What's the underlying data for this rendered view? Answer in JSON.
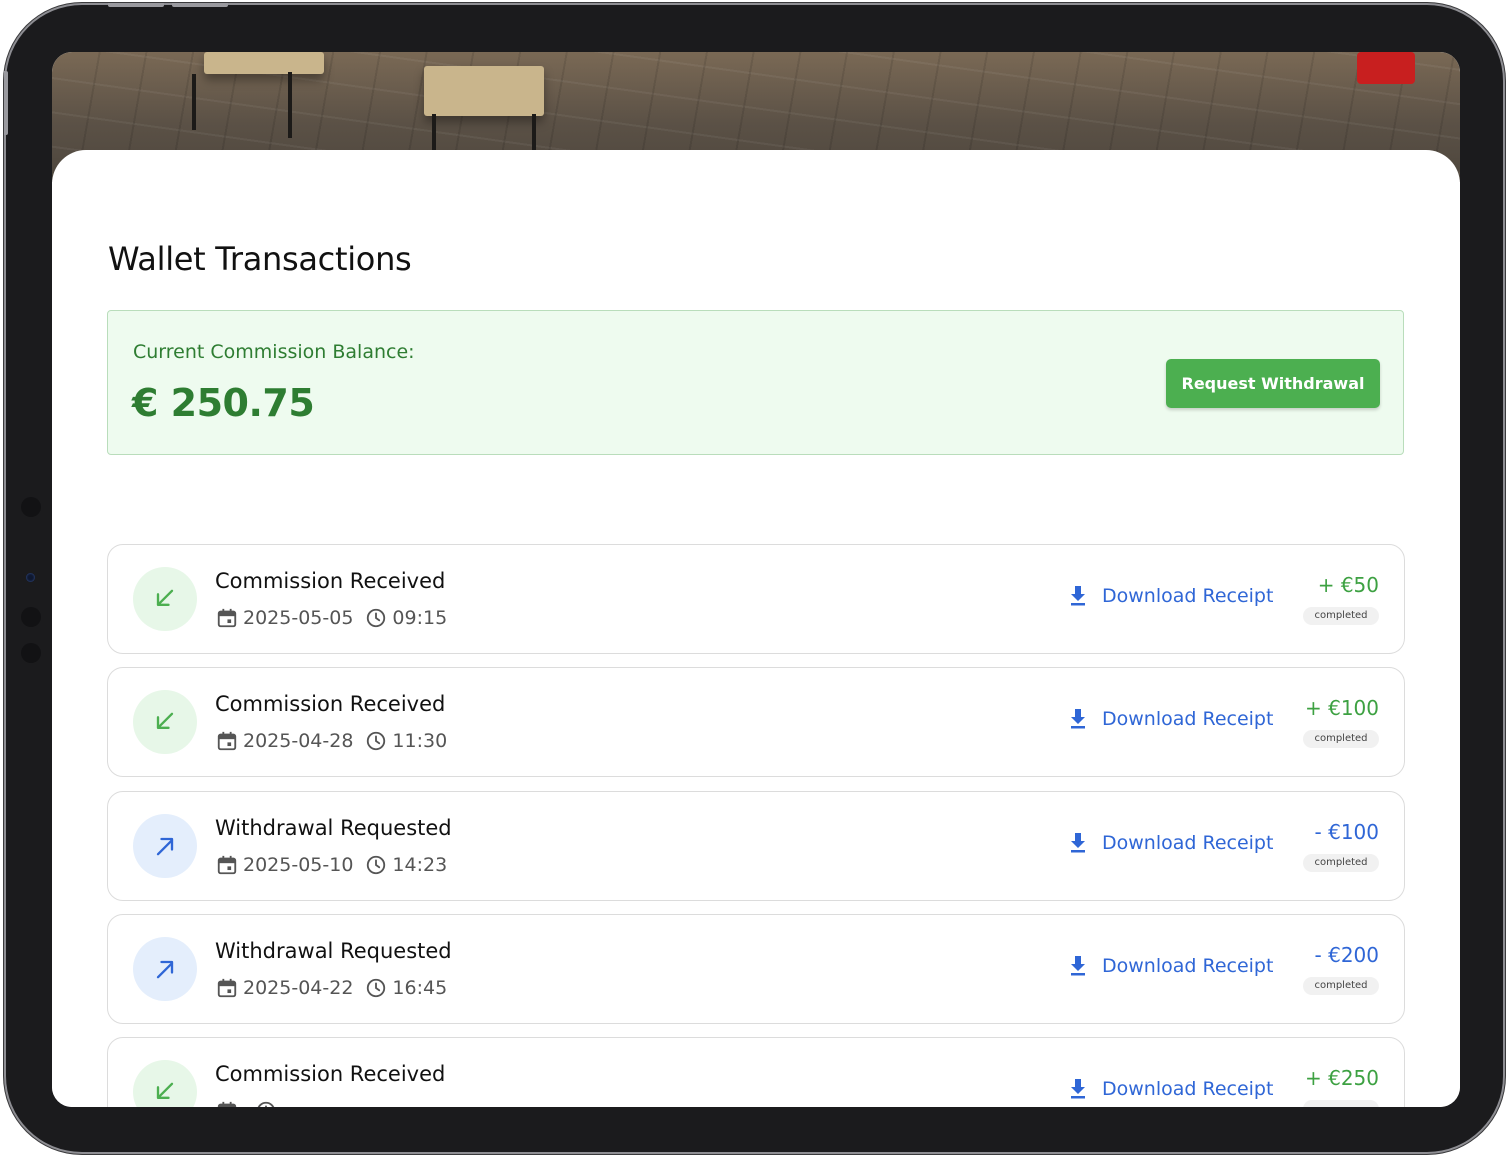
{
  "page": {
    "title": "Wallet Transactions"
  },
  "balance": {
    "label": "Current Commission Balance:",
    "amount": "€ 250.75",
    "withdraw_label": "Request Withdrawal"
  },
  "colors": {
    "accent_green": "#4caf50",
    "balance_text": "#2e7d32",
    "incoming_amount": "#3da142",
    "outgoing_amount": "#2f66d6",
    "link_blue": "#2f66d6"
  },
  "icons": {
    "incoming": "arrow-down-left-icon",
    "outgoing": "arrow-up-right-icon",
    "date": "calendar-icon",
    "time": "clock-icon",
    "receipt": "download-icon"
  },
  "transactions": [
    {
      "kind": "in",
      "title": "Commission Received",
      "date": "2025-05-05",
      "time": "09:15",
      "receipt_label": "Download Receipt",
      "amount": "+ €50",
      "status": "completed"
    },
    {
      "kind": "in",
      "title": "Commission Received",
      "date": "2025-04-28",
      "time": "11:30",
      "receipt_label": "Download Receipt",
      "amount": "+ €100",
      "status": "completed"
    },
    {
      "kind": "out",
      "title": "Withdrawal Requested",
      "date": "2025-05-10",
      "time": "14:23",
      "receipt_label": "Download Receipt",
      "amount": "- €100",
      "status": "completed"
    },
    {
      "kind": "out",
      "title": "Withdrawal Requested",
      "date": "2025-04-22",
      "time": "16:45",
      "receipt_label": "Download Receipt",
      "amount": "- €200",
      "status": "completed"
    },
    {
      "kind": "in",
      "title": "Commission Received",
      "receipt_label": "Download Receipt",
      "amount": "+ €250"
    }
  ]
}
